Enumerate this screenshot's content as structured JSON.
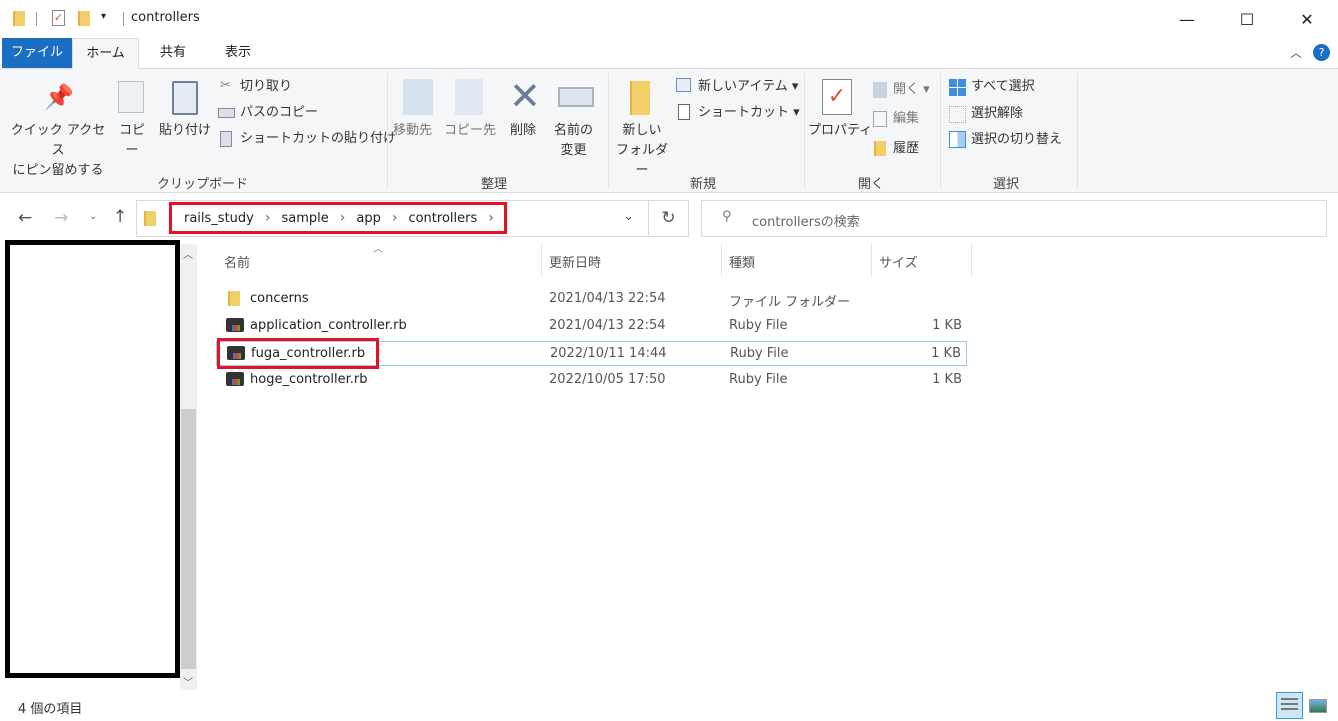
{
  "window": {
    "title": "controllers",
    "minimize": "—",
    "maximize": "☐",
    "close": "✕"
  },
  "tabs": [
    {
      "label": "ファイル"
    },
    {
      "label": "ホーム"
    },
    {
      "label": "共有"
    },
    {
      "label": "表示"
    }
  ],
  "ribbon": {
    "clipboard": {
      "label": "クリップボード",
      "pin": "クイック アクセス",
      "pin2": "にピン留めする",
      "copy": "コピー",
      "paste": "貼り付け",
      "cut": "切り取り",
      "copy_path": "パスのコピー",
      "paste_shortcut": "ショートカットの貼り付け"
    },
    "organize": {
      "label": "整理",
      "move_to": "移動先",
      "copy_to": "コピー先",
      "delete": "削除",
      "rename": "名前の",
      "rename2": "変更"
    },
    "new": {
      "label": "新規",
      "new_folder": "新しい",
      "new_folder2": "フォルダー",
      "new_item": "新しいアイテム ▾",
      "shortcut": "ショートカット ▾"
    },
    "open": {
      "label": "開く",
      "properties": "プロパティ",
      "open": "開く ▾",
      "edit": "編集",
      "history": "履歴"
    },
    "select": {
      "label": "選択",
      "select_all": "すべて選択",
      "select_none": "選択解除",
      "invert": "選択の切り替え"
    }
  },
  "address": {
    "breadcrumb": [
      "rails_study",
      "sample",
      "app",
      "controllers"
    ],
    "search_placeholder": "controllersの検索"
  },
  "columns": [
    "名前",
    "更新日時",
    "種類",
    "サイズ"
  ],
  "files": [
    {
      "name": "concerns",
      "date": "2021/04/13 22:54",
      "type": "ファイル フォルダー",
      "size": "",
      "icon": "folder-icon"
    },
    {
      "name": "application_controller.rb",
      "date": "2021/04/13 22:54",
      "type": "Ruby File",
      "size": "1 KB",
      "icon": "ruby-file-icon"
    },
    {
      "name": "fuga_controller.rb",
      "date": "2022/10/11 14:44",
      "type": "Ruby File",
      "size": "1 KB",
      "icon": "ruby-file-icon",
      "selected": true
    },
    {
      "name": "hoge_controller.rb",
      "date": "2022/10/05 17:50",
      "type": "Ruby File",
      "size": "1 KB",
      "icon": "ruby-file-icon"
    }
  ],
  "status": {
    "count": "4 個の項目"
  },
  "colors": {
    "accent": "#1a6fc2",
    "highlight": "#e81123"
  }
}
